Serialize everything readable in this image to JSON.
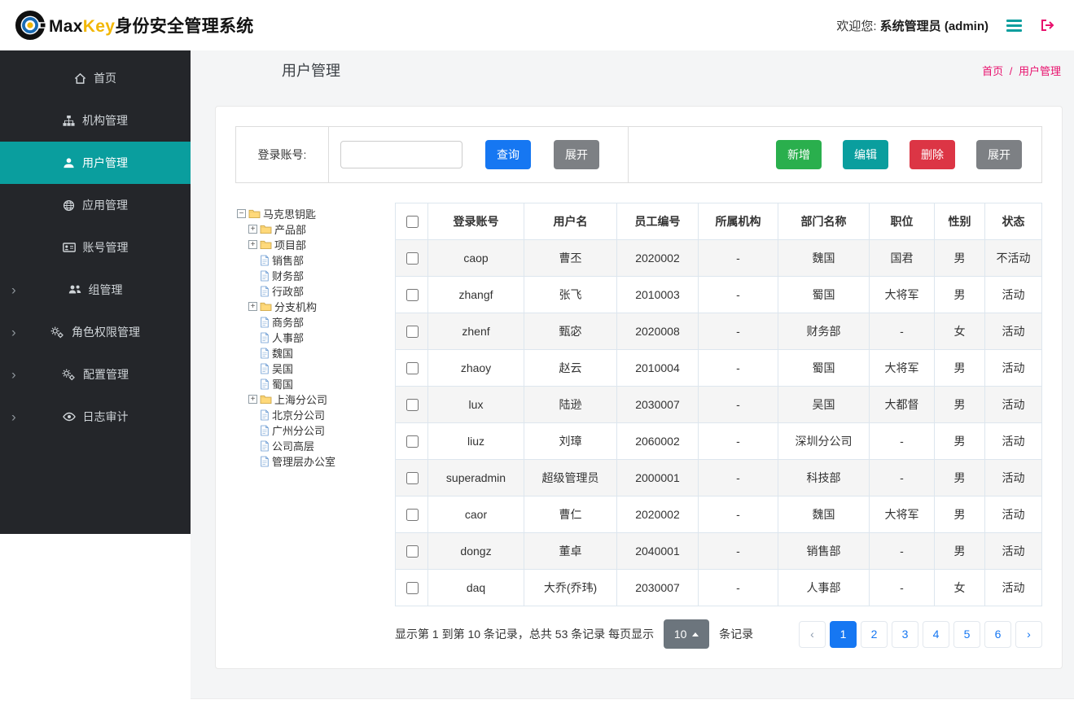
{
  "colors": {
    "primary": "#1677f2",
    "teal": "#0a9e9e",
    "green": "#2aaf4d",
    "red": "#dc3545",
    "gray_btn": "#7d8084",
    "dark_btn": "#6c757d",
    "pink": "#e8116d",
    "brand_yellow": "#f2b705",
    "sidebar_bg": "#24262a"
  },
  "header": {
    "brand_max": "Max",
    "brand_key": "Key",
    "brand_suffix": "身份安全管理系统",
    "welcome_prefix": "欢迎您:",
    "welcome_user": "系统管理员 (admin)"
  },
  "sidebar": {
    "items": [
      {
        "id": "home",
        "label": "首页",
        "icon": "home",
        "expandable": false,
        "active": false
      },
      {
        "id": "org",
        "label": "机构管理",
        "icon": "sitemap",
        "expandable": false,
        "active": false
      },
      {
        "id": "users",
        "label": "用户管理",
        "icon": "user",
        "expandable": false,
        "active": true
      },
      {
        "id": "apps",
        "label": "应用管理",
        "icon": "globe",
        "expandable": false,
        "active": false
      },
      {
        "id": "accounts",
        "label": "账号管理",
        "icon": "idcard",
        "expandable": false,
        "active": false
      },
      {
        "id": "groups",
        "label": "组管理",
        "icon": "group",
        "expandable": true,
        "active": false
      },
      {
        "id": "roles",
        "label": "角色权限管理",
        "icon": "gears",
        "expandable": true,
        "active": false
      },
      {
        "id": "config",
        "label": "配置管理",
        "icon": "gears",
        "expandable": true,
        "active": false
      },
      {
        "id": "audit",
        "label": "日志审计",
        "icon": "eye",
        "expandable": true,
        "active": false
      }
    ]
  },
  "page": {
    "title": "用户管理",
    "breadcrumb_home": "首页",
    "breadcrumb_sep": "/",
    "breadcrumb_current": "用户管理"
  },
  "toolbar": {
    "search_label": "登录账号:",
    "search_value": "",
    "query_label": "查询",
    "expand_label": "展开",
    "add_label": "新增",
    "edit_label": "编辑",
    "delete_label": "删除",
    "expand2_label": "展开"
  },
  "tree": {
    "nodes": [
      {
        "label": "马克思钥匙",
        "type": "folder",
        "expander": "minus",
        "level": 0
      },
      {
        "label": "产品部",
        "type": "folder",
        "expander": "plus",
        "level": 1
      },
      {
        "label": "项目部",
        "type": "folder",
        "expander": "plus",
        "level": 1
      },
      {
        "label": "销售部",
        "type": "file",
        "level": 1
      },
      {
        "label": "财务部",
        "type": "file",
        "level": 1
      },
      {
        "label": "行政部",
        "type": "file",
        "level": 1
      },
      {
        "label": "分支机构",
        "type": "folder",
        "expander": "plus",
        "level": 1
      },
      {
        "label": "商务部",
        "type": "file",
        "level": 1
      },
      {
        "label": "人事部",
        "type": "file",
        "level": 1
      },
      {
        "label": "魏国",
        "type": "file",
        "level": 1
      },
      {
        "label": "吴国",
        "type": "file",
        "level": 1
      },
      {
        "label": "蜀国",
        "type": "file",
        "level": 1
      },
      {
        "label": "上海分公司",
        "type": "folder",
        "expander": "plus",
        "level": 1
      },
      {
        "label": "北京分公司",
        "type": "file",
        "level": 1
      },
      {
        "label": "广州分公司",
        "type": "file",
        "level": 1
      },
      {
        "label": "公司高层",
        "type": "file",
        "level": 1
      },
      {
        "label": "管理层办公室",
        "type": "file",
        "level": 1
      }
    ]
  },
  "table": {
    "columns": [
      "登录账号",
      "用户名",
      "员工编号",
      "所属机构",
      "部门名称",
      "职位",
      "性别",
      "状态"
    ],
    "rows": [
      [
        "caop",
        "曹丕",
        "2020002",
        "-",
        "魏国",
        "国君",
        "男",
        "不活动"
      ],
      [
        "zhangf",
        "张飞",
        "2010003",
        "-",
        "蜀国",
        "大将军",
        "男",
        "活动"
      ],
      [
        "zhenf",
        "甄宓",
        "2020008",
        "-",
        "财务部",
        "-",
        "女",
        "活动"
      ],
      [
        "zhaoy",
        "赵云",
        "2010004",
        "-",
        "蜀国",
        "大将军",
        "男",
        "活动"
      ],
      [
        "lux",
        "陆逊",
        "2030007",
        "-",
        "吴国",
        "大都督",
        "男",
        "活动"
      ],
      [
        "liuz",
        "刘璋",
        "2060002",
        "-",
        "深圳分公司",
        "-",
        "男",
        "活动"
      ],
      [
        "superadmin",
        "超级管理员",
        "2000001",
        "-",
        "科技部",
        "-",
        "男",
        "活动"
      ],
      [
        "caor",
        "曹仁",
        "2020002",
        "-",
        "魏国",
        "大将军",
        "男",
        "活动"
      ],
      [
        "dongz",
        "董卓",
        "2040001",
        "-",
        "销售部",
        "-",
        "男",
        "活动"
      ],
      [
        "daq",
        "大乔(乔玮)",
        "2030007",
        "-",
        "人事部",
        "-",
        "女",
        "活动"
      ]
    ]
  },
  "pagination": {
    "summary_before": "显示第 1 到第 10 条记录，总共 53 条记录  每页显示",
    "page_size": "10",
    "summary_after": "条记录",
    "prev_icon": "‹",
    "next_icon": "›",
    "pages": [
      "1",
      "2",
      "3",
      "4",
      "5",
      "6"
    ],
    "active_page": "1"
  }
}
